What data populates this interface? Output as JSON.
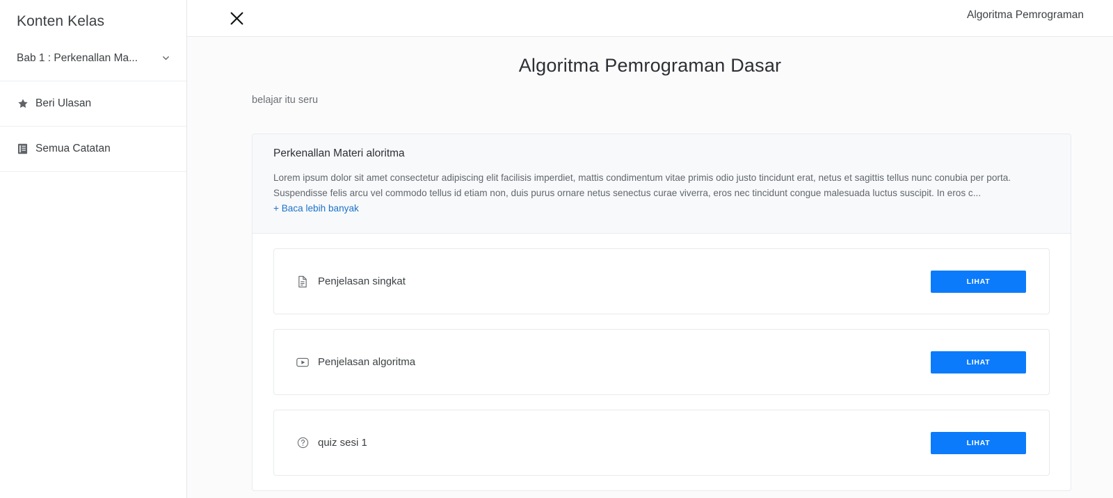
{
  "sidebar": {
    "title": "Konten Kelas",
    "chapter": {
      "label": "Bab 1 : Perkenallan Ma...",
      "icon": "chevron-down-icon"
    },
    "items": [
      {
        "label": "Beri Ulasan",
        "icon": "star-icon"
      },
      {
        "label": "Semua Catatan",
        "icon": "book-icon"
      }
    ]
  },
  "topbar": {
    "close_icon": "close-icon",
    "title": "Algoritma Pemrograman"
  },
  "main": {
    "title": "Algoritma Pemrograman Dasar",
    "subtitle": "belajar itu seru",
    "section": {
      "title": "Perkenallan Materi aloritma",
      "description": "Lorem ipsum dolor sit amet consectetur adipiscing elit facilisis imperdiet, mattis condimentum vitae primis odio justo tincidunt erat, netus et sagittis tellus nunc conubia per porta. Suspendisse felis arcu vel commodo tellus id etiam non, duis purus ornare netus senectus curae viverra, eros nec tincidunt congue malesuada luctus suscipit. In eros c...",
      "read_more": "+ Baca lebih banyak"
    },
    "rows": [
      {
        "label": "Penjelasan singkat",
        "icon": "document-icon",
        "button": "LIHAT"
      },
      {
        "label": "Penjelasan algoritma",
        "icon": "video-icon",
        "button": "LIHAT"
      },
      {
        "label": "quiz sesi 1",
        "icon": "question-circle-icon",
        "button": "LIHAT"
      }
    ]
  },
  "colors": {
    "primary_button": "#0b7bfb",
    "link": "#1a73c8",
    "section_bg": "#f8f9fb",
    "border": "#e7eaee",
    "page_bg": "#fbfbfc"
  }
}
